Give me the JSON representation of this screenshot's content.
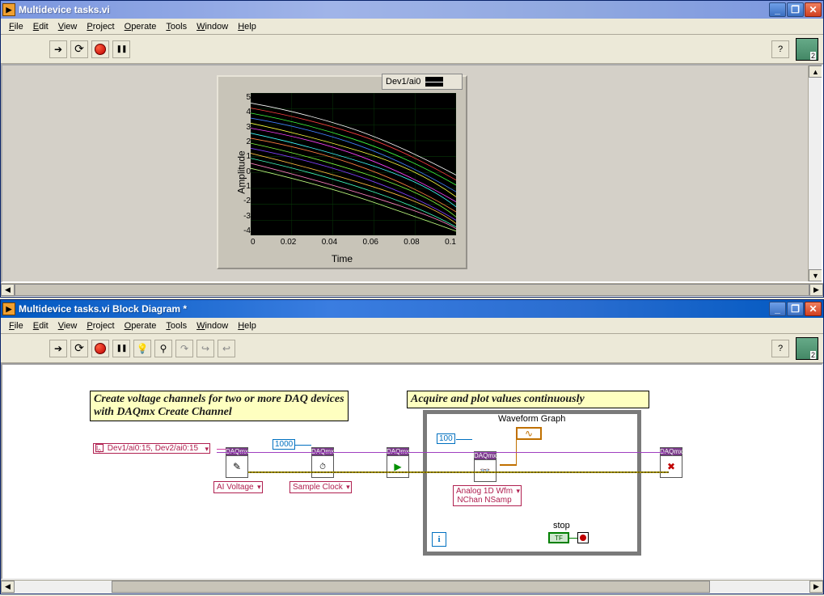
{
  "front": {
    "title": "Multidevice tasks.vi",
    "menus": [
      "File",
      "Edit",
      "View",
      "Project",
      "Operate",
      "Tools",
      "Window",
      "Help"
    ],
    "chart": {
      "legend": "Dev1/ai0",
      "ylabel": "Amplitude",
      "xlabel": "Time",
      "yticks": [
        "5",
        "4",
        "3",
        "2",
        "1",
        "0",
        "-1",
        "-2",
        "-3",
        "-4"
      ],
      "xticks": [
        "0",
        "0.02",
        "0.04",
        "0.06",
        "0.08",
        "0.1"
      ]
    }
  },
  "block": {
    "title": "Multidevice tasks.vi Block Diagram *",
    "menus": [
      "File",
      "Edit",
      "View",
      "Project",
      "Operate",
      "Tools",
      "Window",
      "Help"
    ],
    "comment1": "Create voltage channels for two or more DAQ devices with DAQmx Create Channel",
    "comment2": "Acquire and plot values continuously",
    "chan_const": "Dev1/ai0:15, Dev2/ai0:15",
    "rate_const": "1000",
    "samp_const": "100",
    "daqmx_label": "DAQmx",
    "poly_ai": "AI Voltage",
    "poly_clock": "Sample Clock",
    "poly_read_l1": "Analog 1D Wfm",
    "poly_read_l2": "NChan NSamp",
    "wf_label": "Waveform Graph",
    "stop_label": "stop",
    "stop_tf": "TF",
    "iter": "i"
  },
  "help_char": "?",
  "winbtn": {
    "min": "_",
    "max": "❐",
    "close": "✕"
  },
  "chart_data": {
    "type": "line",
    "xlabel": "Time",
    "ylabel": "Amplitude",
    "xlim": [
      0,
      0.1
    ],
    "ylim": [
      -4,
      5
    ],
    "xticks": [
      0,
      0.02,
      0.04,
      0.06,
      0.08,
      0.1
    ],
    "yticks": [
      -4,
      -3,
      -2,
      -1,
      0,
      1,
      2,
      3,
      4,
      5
    ],
    "note": "~16 noisy descending traces; visual only, values not individually labeled",
    "series_count": 16
  }
}
